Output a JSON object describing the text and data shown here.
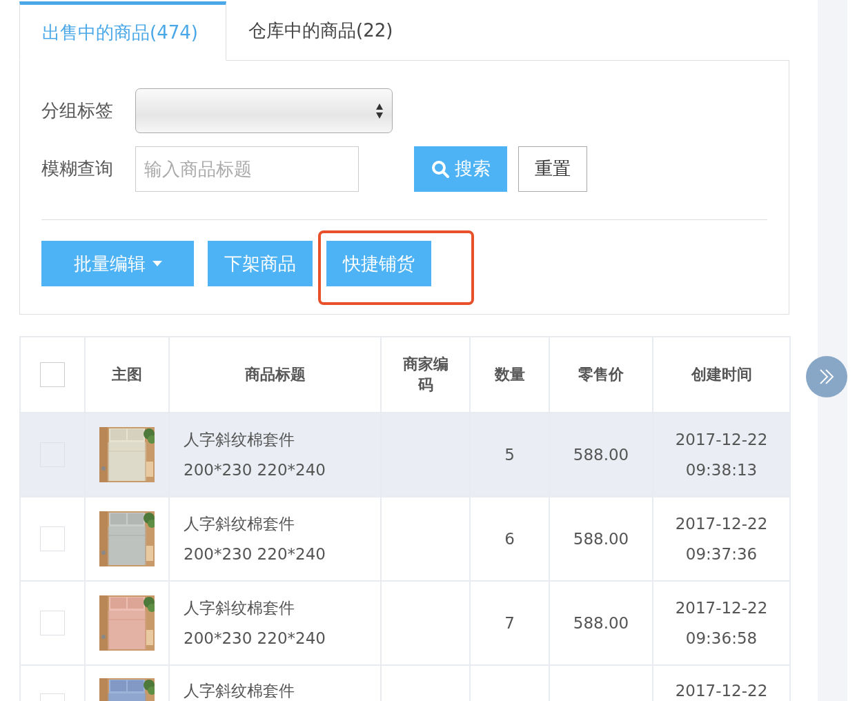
{
  "tabs": [
    {
      "label": "出售中的商品(474)",
      "selected": true
    },
    {
      "label": "仓库中的商品(22)",
      "selected": false
    }
  ],
  "filters": {
    "group_label": "分组标签",
    "fuzzy_label": "模糊查询",
    "search_field": {
      "placeholder": "输入商品标题"
    },
    "search_button": "搜索",
    "reset_button": "重置"
  },
  "actions": [
    {
      "label": "批量编辑",
      "kind": "dropdown",
      "highlighted": false
    },
    {
      "label": "下架商品",
      "kind": "plain",
      "highlighted": false
    },
    {
      "label": "快捷铺货",
      "kind": "plain",
      "highlighted": true
    }
  ],
  "table": {
    "select_all": {
      "checked": false
    },
    "columns": [
      "主图",
      "商品标题",
      "商家编码",
      "数量",
      "零售价",
      "创建时间"
    ],
    "rows": [
      {
        "checked": false,
        "hovered": true,
        "title_line1": "人字斜纹棉套件",
        "title_line2": "200*230 220*240",
        "quantity": "5",
        "price": "588.00",
        "date": "2017-12-22",
        "time": "09:38:13"
      },
      {
        "checked": false,
        "hovered": false,
        "title_line1": "人字斜纹棉套件",
        "title_line2": "200*230 220*240",
        "quantity": "6",
        "price": "588.00",
        "date": "2017-12-22",
        "time": "09:37:36"
      },
      {
        "checked": false,
        "hovered": false,
        "title_line1": "人字斜纹棉套件",
        "title_line2": "200*230 220*240",
        "quantity": "7",
        "price": "588.00",
        "date": "2017-12-22",
        "time": "09:36:58"
      },
      {
        "checked": false,
        "hovered": false,
        "title_line1": "人字斜纹棉套件",
        "date": "2017-12-22"
      }
    ]
  }
}
